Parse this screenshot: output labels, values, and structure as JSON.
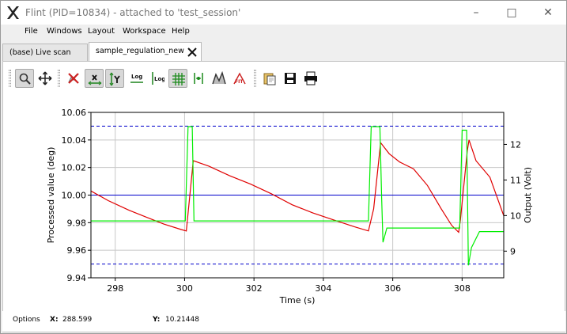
{
  "window": {
    "title": "Flint (PID=10834) - attached to 'test_session'",
    "controls": [
      "–",
      "□",
      "✕"
    ]
  },
  "menu": [
    "File",
    "Windows",
    "Layout",
    "Workspace",
    "Help"
  ],
  "tabs": [
    {
      "label": "(base) Live scan",
      "active": false
    },
    {
      "label": "sample_regulation_new",
      "active": true
    }
  ],
  "toolbar": {
    "buttons": [
      {
        "icon": "zoom-icon",
        "checked": true
      },
      {
        "icon": "pan-icon",
        "checked": false
      },
      {
        "icon": "reset-zoom-icon",
        "checked": false
      },
      {
        "icon": "x-axis-autoscale-icon",
        "checked": true
      },
      {
        "icon": "y-axis-autoscale-icon",
        "checked": true
      },
      {
        "icon": "x-log-icon",
        "checked": false
      },
      {
        "icon": "y-log-icon",
        "checked": false
      },
      {
        "icon": "grid-icon",
        "checked": true
      },
      {
        "icon": "crosshair-icon",
        "checked": false
      },
      {
        "icon": "curve-style-icon",
        "checked": false
      },
      {
        "icon": "fit-icon",
        "checked": false
      },
      {
        "icon": "copy-to-clipboard-icon",
        "checked": false
      },
      {
        "icon": "save-icon",
        "checked": false
      },
      {
        "icon": "print-icon",
        "checked": false
      }
    ],
    "log_label": "Log",
    "fit_label": "FIT"
  },
  "status": {
    "options_label": "Options",
    "x_label": "X:",
    "x_value": "288.599",
    "y_label": "Y:",
    "y_value": "10.21448"
  },
  "colors": {
    "processed": "#e00000",
    "output": "#00ee00",
    "setpoint": "#0000cc",
    "limits": "#0000cc"
  },
  "chart_data": {
    "type": "line",
    "xlabel": "Time (s)",
    "ylabel": "Processed value (deg)",
    "y2label": "Output (Volt)",
    "xlim": [
      297.3,
      309.2
    ],
    "ylim": [
      9.94,
      10.06
    ],
    "y2lim": [
      8.25,
      12.9
    ],
    "xticks": [
      298,
      300,
      302,
      304,
      306,
      308
    ],
    "yticks": [
      9.94,
      9.96,
      9.98,
      10.0,
      10.02,
      10.04,
      10.06
    ],
    "ytick_labels": [
      "9.94",
      "9.96",
      "9.98",
      "10.00",
      "10.02",
      "10.04",
      "10.06"
    ],
    "y2ticks": [
      9,
      10,
      11,
      12
    ],
    "grid": true,
    "hlines": [
      {
        "y": 10.05,
        "style": "dashed",
        "axis": "left"
      },
      {
        "y": 10.0,
        "style": "solid",
        "axis": "left"
      },
      {
        "y": 9.95,
        "style": "dashed",
        "axis": "left"
      }
    ],
    "series": [
      {
        "axis": "left",
        "color": "#e00000",
        "x": [
          297.3,
          297.8,
          298.4,
          298.9,
          299.4,
          299.9,
          300.05,
          300.25,
          300.7,
          301.3,
          301.9,
          302.5,
          303.1,
          303.7,
          304.3,
          304.9,
          305.3,
          305.45,
          305.65,
          305.9,
          306.2,
          306.6,
          307.0,
          307.4,
          307.7,
          307.9,
          307.95,
          308.15,
          308.2,
          308.4,
          308.8,
          309.2
        ],
        "values": [
          10.003,
          9.996,
          9.989,
          9.984,
          9.979,
          9.975,
          9.974,
          10.025,
          10.021,
          10.014,
          10.008,
          10.001,
          9.993,
          9.987,
          9.982,
          9.977,
          9.974,
          9.99,
          10.038,
          10.03,
          10.024,
          10.019,
          10.007,
          9.99,
          9.978,
          9.973,
          9.982,
          10.032,
          10.04,
          10.025,
          10.013,
          9.985
        ]
      },
      {
        "axis": "right",
        "color": "#00ee00",
        "x": [
          297.3,
          300.02,
          300.1,
          300.22,
          300.27,
          305.3,
          305.38,
          305.63,
          305.68,
          305.72,
          305.83,
          305.95,
          307.93,
          308.0,
          308.13,
          308.18,
          308.27,
          308.5,
          309.2
        ],
        "values": [
          9.85,
          9.85,
          12.5,
          12.5,
          9.85,
          9.85,
          12.5,
          12.5,
          10.5,
          9.25,
          9.65,
          9.65,
          9.65,
          12.4,
          12.4,
          8.6,
          9.1,
          9.55,
          9.55
        ]
      }
    ]
  }
}
